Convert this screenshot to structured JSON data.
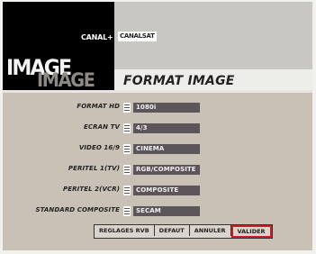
{
  "brand": {
    "canal_plus": "CANAL+",
    "canalsat": "CANALSAT"
  },
  "section": {
    "big_word_top": "IMAGE",
    "big_word_shadow": "IMAGE",
    "title": "FORMAT IMAGE"
  },
  "settings": [
    {
      "label": "FORMAT HD",
      "value": "1080i"
    },
    {
      "label": "ECRAN TV",
      "value": "4/3"
    },
    {
      "label": "VIDEO 16/9",
      "value": "CINEMA"
    },
    {
      "label": "PERITEL 1(TV)",
      "value": "RGB/COMPOSITE"
    },
    {
      "label": "PERITEL 2(VCR)",
      "value": "COMPOSITE"
    },
    {
      "label": "STANDARD COMPOSITE",
      "value": "SECAM"
    }
  ],
  "buttons": {
    "rgb_settings": "REGLAGES RVB",
    "default": "DEFAUT",
    "cancel": "ANNULER",
    "validate": "VALIDER"
  },
  "colors": {
    "panel_bg": "#c9c1b6",
    "field_bg": "#5c5559",
    "focus_border": "#c82020"
  }
}
